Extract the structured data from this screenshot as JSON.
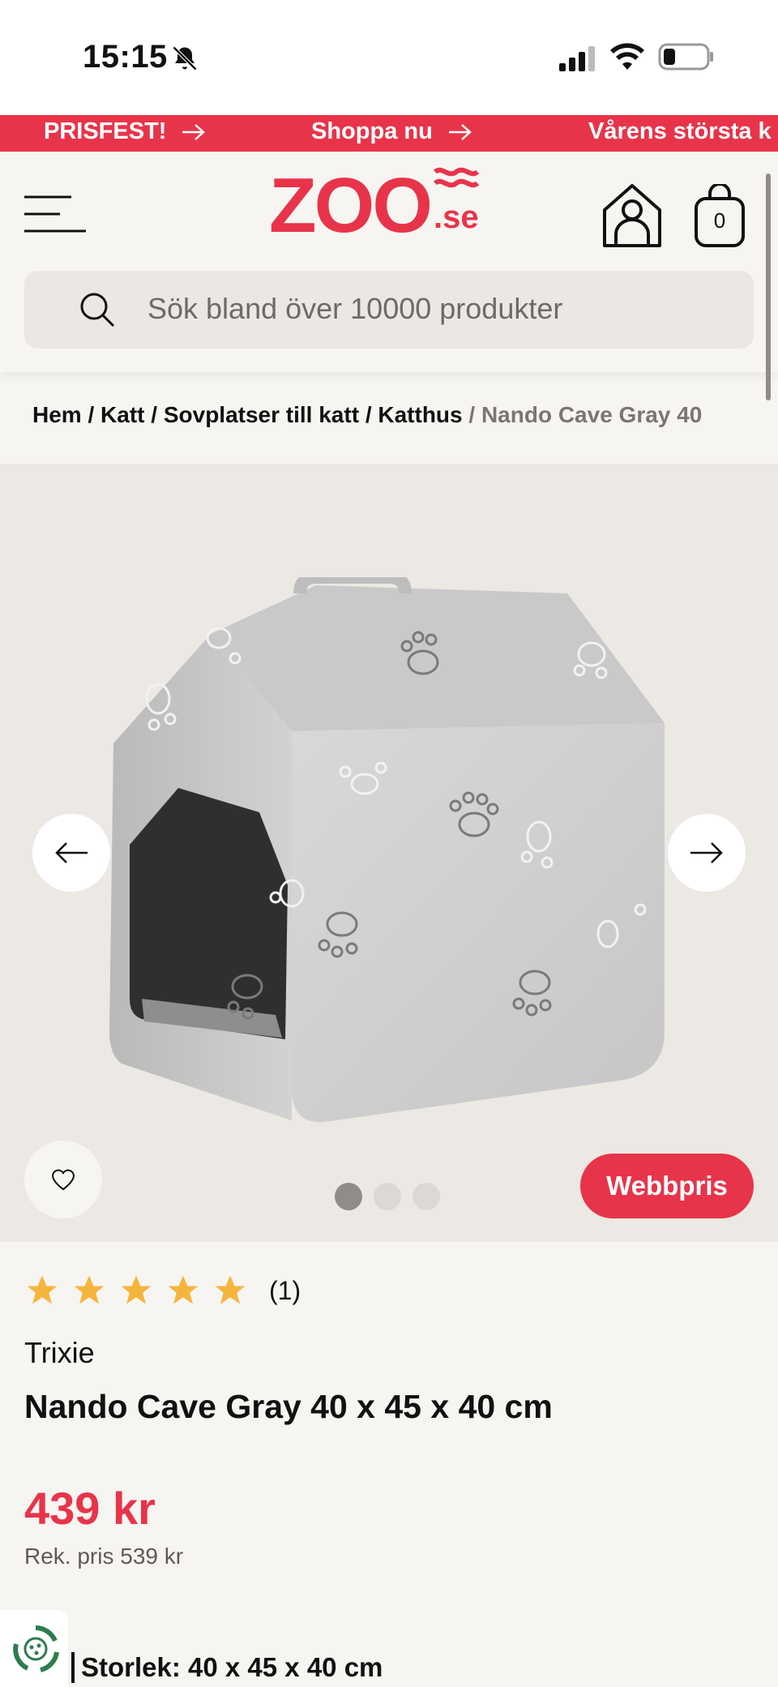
{
  "status_bar": {
    "time": "15:15",
    "icons": [
      "bell-slash-icon",
      "signal-icon",
      "wifi-icon",
      "battery-icon"
    ]
  },
  "promo": {
    "items": [
      "PRISFEST!",
      "Shoppa nu",
      "Vårens största k"
    ],
    "color": "#e8344a"
  },
  "header": {
    "logo_text": "ZOO",
    "logo_suffix": ".se",
    "cart_count": "0",
    "search_placeholder": "Sök bland över 10000 produkter"
  },
  "breadcrumb": {
    "items": [
      "Hem",
      "Katt",
      "Sovplatser till katt",
      "Katthus"
    ],
    "current": "Nando Cave Gray 40",
    "separator": "/"
  },
  "gallery": {
    "badge": "Webbpris",
    "dot_count": 3,
    "active_dot": 0,
    "image": "grey-plush-cat-house-with-paw-prints"
  },
  "product": {
    "rating": 5,
    "review_count": "(1)",
    "brand": "Trixie",
    "title": "Nando Cave Gray 40 x 45 x 40 cm",
    "price": "439 kr",
    "recommended_price": "Rek. pris 539 kr",
    "size_label": "Storlek: 40 x 45 x 40 cm"
  },
  "colors": {
    "accent": "#e8344a",
    "star": "#f5b53d",
    "background": "#f7f5f2"
  }
}
